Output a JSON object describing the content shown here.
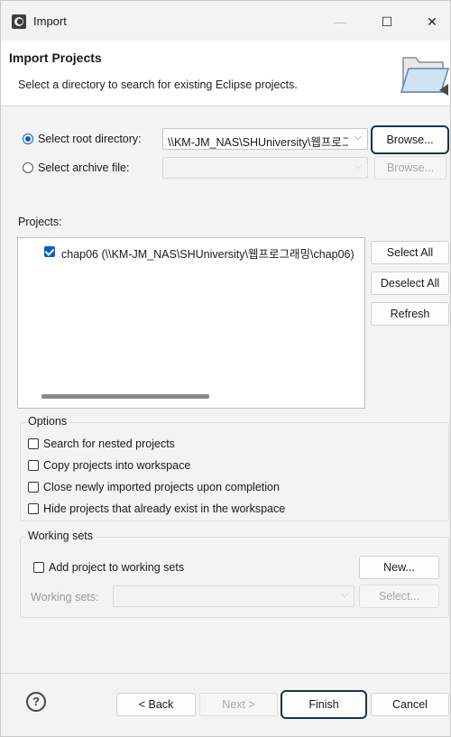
{
  "window": {
    "title": "Import"
  },
  "banner": {
    "title": "Import Projects",
    "description": "Select a directory to search for existing Eclipse projects."
  },
  "source": {
    "root_dir_label": "Select root directory:",
    "root_dir_value": "\\\\KM-JM_NAS\\SHUniversity\\웹프로그래밍",
    "browse_label": "Browse...",
    "archive_label": "Select archive file:",
    "archive_value": "",
    "archive_browse_label": "Browse..."
  },
  "projects": {
    "label": "Projects:",
    "items": [
      {
        "name": "chap06 (\\\\KM-JM_NAS\\SHUniversity\\웹프로그래밍\\chap06)"
      }
    ],
    "select_all": "Select All",
    "deselect_all": "Deselect All",
    "refresh": "Refresh"
  },
  "options": {
    "title": "Options",
    "search_nested": "Search for nested projects",
    "copy_projects": "Copy projects into workspace",
    "close_imported": "Close newly imported projects upon completion",
    "hide_existing": "Hide projects that already exist in the workspace"
  },
  "working_sets": {
    "title": "Working sets",
    "add_label": "Add project to working sets",
    "new_label": "New...",
    "sets_label": "Working sets:",
    "sets_value": "",
    "select_label": "Select..."
  },
  "footer": {
    "back": "< Back",
    "next": "Next >",
    "finish": "Finish",
    "cancel": "Cancel"
  }
}
